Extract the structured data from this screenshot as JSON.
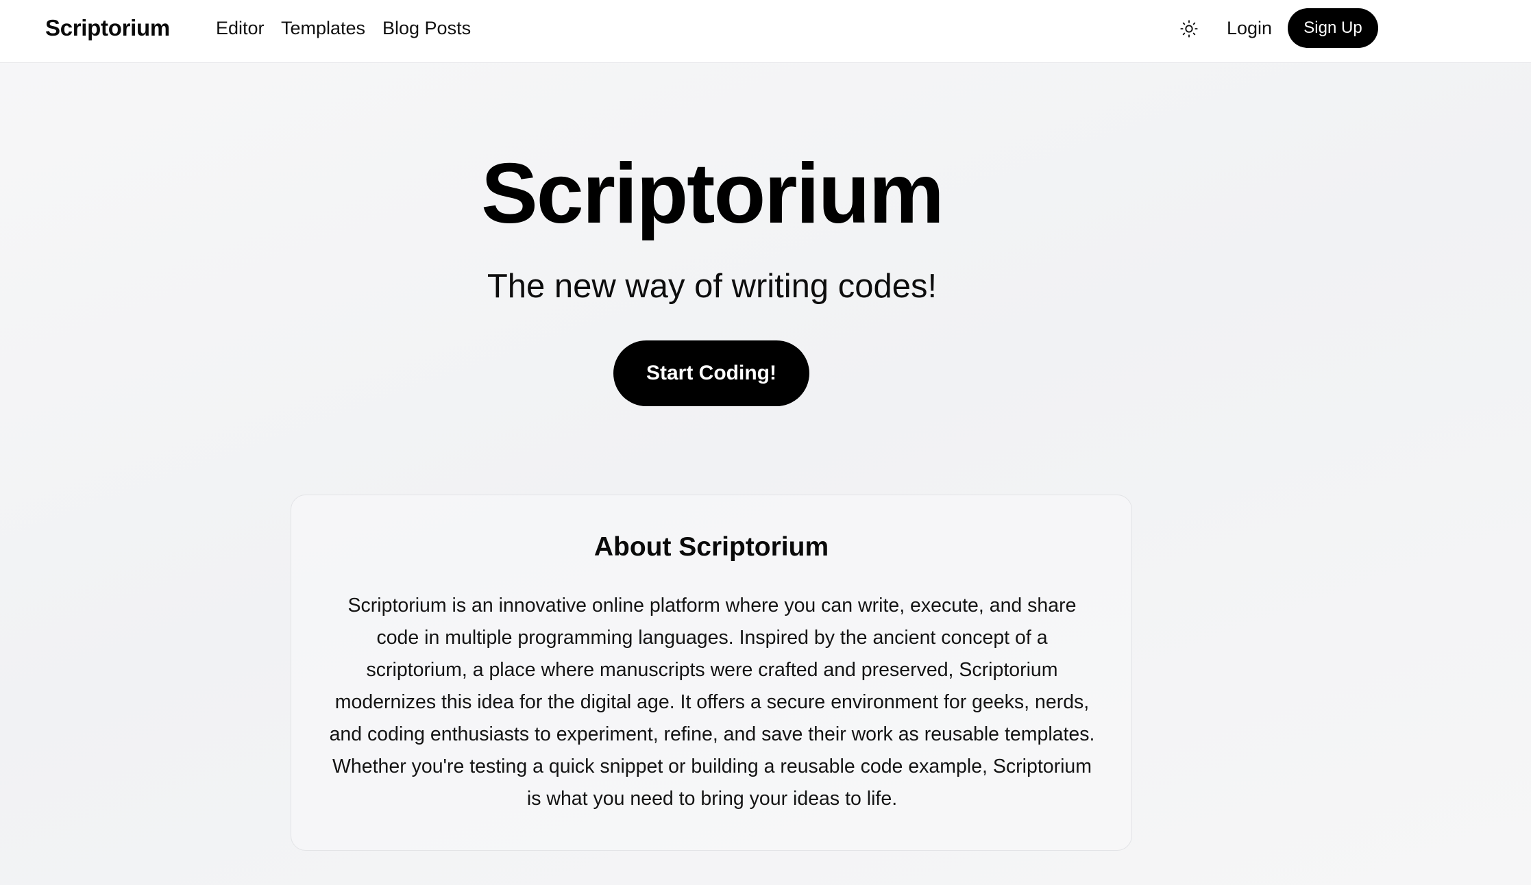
{
  "nav": {
    "brand": "Scriptorium",
    "links": [
      {
        "label": "Editor"
      },
      {
        "label": "Templates"
      },
      {
        "label": "Blog Posts"
      }
    ],
    "theme_icon": "sun-icon",
    "login_label": "Login",
    "signup_label": "Sign Up"
  },
  "hero": {
    "title": "Scriptorium",
    "subtitle": "The new way of writing codes!",
    "cta_label": "Start Coding!"
  },
  "about": {
    "title": "About Scriptorium",
    "body": "Scriptorium is an innovative online platform where you can write, execute, and share code in multiple programming languages. Inspired by the ancient concept of a scriptorium, a place where manuscripts were crafted and preserved, Scriptorium modernizes this idea for the digital age. It offers a secure environment for geeks, nerds, and coding enthusiasts to experiment, refine, and save their work as reusable templates. Whether you're testing a quick snippet or building a reusable code example, Scriptorium is what you need to bring your ideas to life."
  },
  "colors": {
    "primary_button": "#000000",
    "primary_button_text": "#ffffff",
    "page_background": "#f3f4f6",
    "navbar_background": "#ffffff"
  }
}
